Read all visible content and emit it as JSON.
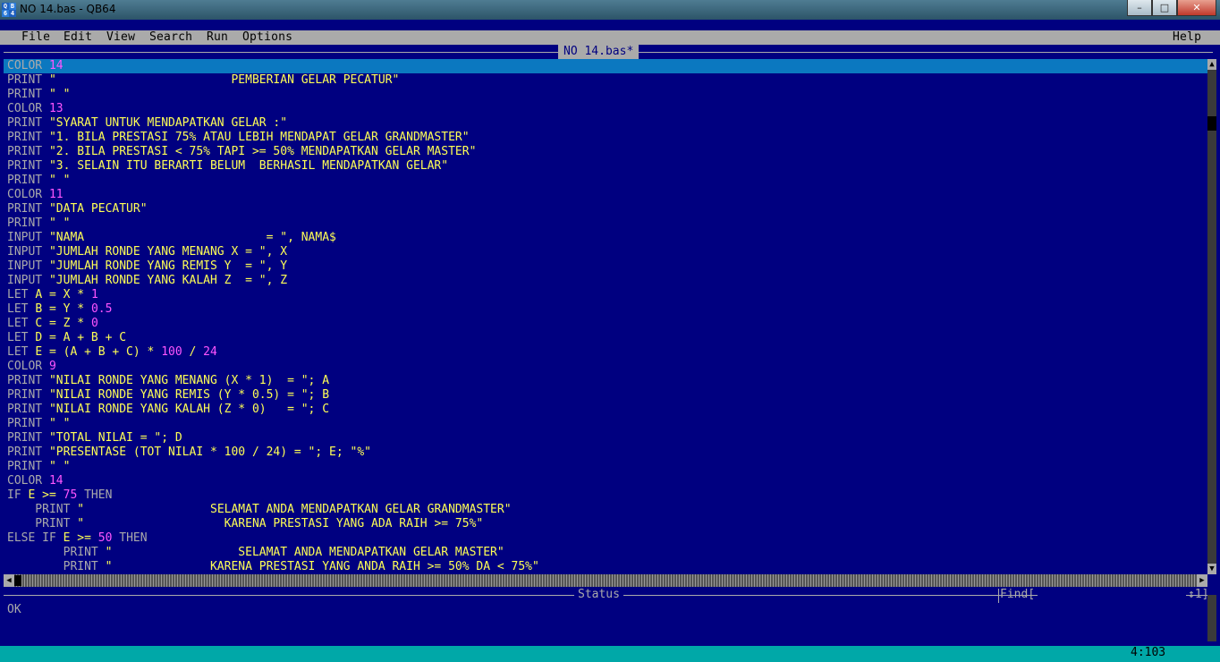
{
  "window": {
    "title": "NO 14.bas - QB64",
    "icon_text": [
      "Q",
      "B",
      "6",
      "4"
    ],
    "buttons": [
      "minimize-icon",
      "maximize-icon",
      "close-icon"
    ]
  },
  "menu": {
    "items": [
      "File",
      "Edit",
      "View",
      "Search",
      "Run",
      "Options"
    ],
    "help": "Help"
  },
  "editor": {
    "file_title": "NO 14.bas*",
    "lines": [
      [
        [
          "COLOR ",
          "kw"
        ],
        [
          "14",
          "num"
        ]
      ],
      [
        [
          "PRINT ",
          "kw"
        ],
        [
          "\"                         PEMBERIAN GELAR PECATUR\"",
          ""
        ]
      ],
      [
        [
          "PRINT ",
          "kw"
        ],
        [
          "\" \"",
          ""
        ]
      ],
      [
        [
          "COLOR ",
          "kw"
        ],
        [
          "13",
          "num"
        ]
      ],
      [
        [
          "PRINT ",
          "kw"
        ],
        [
          "\"SYARAT UNTUK MENDAPATKAN GELAR :\"",
          ""
        ]
      ],
      [
        [
          "PRINT ",
          "kw"
        ],
        [
          "\"1. BILA PRESTASI 75% ATAU LEBIH MENDAPAT GELAR GRANDMASTER\"",
          ""
        ]
      ],
      [
        [
          "PRINT ",
          "kw"
        ],
        [
          "\"2. BILA PRESTASI < 75% TAPI >= 50% MENDAPATKAN GELAR MASTER\"",
          ""
        ]
      ],
      [
        [
          "PRINT ",
          "kw"
        ],
        [
          "\"3. SELAIN ITU BERARTI BELUM  BERHASIL MENDAPATKAN GELAR\"",
          ""
        ]
      ],
      [
        [
          "PRINT ",
          "kw"
        ],
        [
          "\" \"",
          ""
        ]
      ],
      [
        [
          "COLOR ",
          "kw"
        ],
        [
          "11",
          "num"
        ]
      ],
      [
        [
          "PRINT ",
          "kw"
        ],
        [
          "\"DATA PECATUR\"",
          ""
        ]
      ],
      [
        [
          "PRINT ",
          "kw"
        ],
        [
          "\" \"",
          ""
        ]
      ],
      [
        [
          "INPUT ",
          "kw"
        ],
        [
          "\"NAMA                          = \", NAMA$",
          ""
        ]
      ],
      [
        [
          "INPUT ",
          "kw"
        ],
        [
          "\"JUMLAH RONDE YANG MENANG X = \", X",
          ""
        ]
      ],
      [
        [
          "INPUT ",
          "kw"
        ],
        [
          "\"JUMLAH RONDE YANG REMIS Y  = \", Y",
          ""
        ]
      ],
      [
        [
          "INPUT ",
          "kw"
        ],
        [
          "\"JUMLAH RONDE YANG KALAH Z  = \", Z",
          ""
        ]
      ],
      [
        [
          "LET ",
          "kw"
        ],
        [
          "A = X * ",
          ""
        ],
        [
          "1",
          "num"
        ]
      ],
      [
        [
          "LET ",
          "kw"
        ],
        [
          "B = Y * ",
          ""
        ],
        [
          "0.5",
          "num"
        ]
      ],
      [
        [
          "LET ",
          "kw"
        ],
        [
          "C = Z * ",
          ""
        ],
        [
          "0",
          "num"
        ]
      ],
      [
        [
          "LET ",
          "kw"
        ],
        [
          "D = A + B + C",
          ""
        ]
      ],
      [
        [
          "LET ",
          "kw"
        ],
        [
          "E = (A + B + C) * ",
          ""
        ],
        [
          "100",
          "num"
        ],
        [
          " / ",
          ""
        ],
        [
          "24",
          "num"
        ]
      ],
      [
        [
          "COLOR ",
          "kw"
        ],
        [
          "9",
          "num"
        ]
      ],
      [
        [
          "PRINT ",
          "kw"
        ],
        [
          "\"NILAI RONDE YANG MENANG (X * 1)  = \"; A",
          ""
        ]
      ],
      [
        [
          "PRINT ",
          "kw"
        ],
        [
          "\"NILAI RONDE YANG REMIS (Y * 0.5) = \"; B",
          ""
        ]
      ],
      [
        [
          "PRINT ",
          "kw"
        ],
        [
          "\"NILAI RONDE YANG KALAH (Z * 0)   = \"; C",
          ""
        ]
      ],
      [
        [
          "PRINT ",
          "kw"
        ],
        [
          "\" \"",
          ""
        ]
      ],
      [
        [
          "PRINT ",
          "kw"
        ],
        [
          "\"TOTAL NILAI = \"; D",
          ""
        ]
      ],
      [
        [
          "PRINT ",
          "kw"
        ],
        [
          "\"PRESENTASE (TOT NILAI * 100 / 24) = \"; E; \"%\"",
          ""
        ]
      ],
      [
        [
          "PRINT ",
          "kw"
        ],
        [
          "\" \"",
          ""
        ]
      ],
      [
        [
          "COLOR ",
          "kw"
        ],
        [
          "14",
          "num"
        ]
      ],
      [
        [
          "IF ",
          "kw"
        ],
        [
          "E >= ",
          ""
        ],
        [
          "75",
          "num"
        ],
        [
          " THEN",
          "kw"
        ]
      ],
      [
        [
          "    PRINT ",
          "kw"
        ],
        [
          "\"                  SELAMAT ANDA MENDAPATKAN GELAR GRANDMASTER\"",
          ""
        ]
      ],
      [
        [
          "    PRINT ",
          "kw"
        ],
        [
          "\"                    KARENA PRESTASI YANG ADA RAIH >= 75%\"",
          ""
        ]
      ],
      [
        [
          "ELSE IF ",
          "kw"
        ],
        [
          "E >= ",
          ""
        ],
        [
          "50",
          "num"
        ],
        [
          " THEN",
          "kw"
        ]
      ],
      [
        [
          "        PRINT ",
          "kw"
        ],
        [
          "\"                  SELAMAT ANDA MENDAPATKAN GELAR MASTER\"",
          ""
        ]
      ],
      [
        [
          "        PRINT ",
          "kw"
        ],
        [
          "\"              KARENA PRESTASI YANG ANDA RAIH >= 50% DA < 75%\"",
          ""
        ]
      ]
    ]
  },
  "status": {
    "label": "Status",
    "message": "OK",
    "find_label": "Find[",
    "find_arrows": "↕1]"
  },
  "footer": {
    "cursor_position": "4:103"
  },
  "colors": {
    "background": "#000080",
    "text": "#ffff55",
    "keyword": "#aaaaaa",
    "number": "#ff55ff",
    "selection": "#0b78c0",
    "footer": "#00a8a8"
  }
}
